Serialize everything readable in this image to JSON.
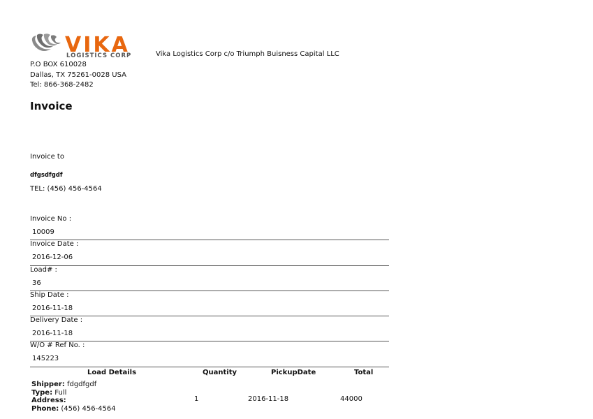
{
  "company": {
    "logo_text": "VIKA",
    "logo_subtext": "LOGISTICS CORP",
    "name": "Vika Logistics Corp c/o Triumph Buisness Capital LLC",
    "address_line1": "P.O BOX 610028",
    "address_line2": "Dallas, TX 75261-0028 USA",
    "tel": "Tel: 866-368-2482",
    "brand_color": "#e8670f",
    "swirl_color": "#7a7a7a"
  },
  "document": {
    "title": "Invoice"
  },
  "bill_to": {
    "label": "Invoice to",
    "name": "dfgsdfgdf",
    "tel": "TEL: (456) 456-4564"
  },
  "meta": [
    {
      "label": "Invoice No :",
      "value": "10009"
    },
    {
      "label": "Invoice Date :",
      "value": "2016-12-06"
    },
    {
      "label": "Load# :",
      "value": "36"
    },
    {
      "label": "Ship Date :",
      "value": "2016-11-18"
    },
    {
      "label": "Delivery Date :",
      "value": "2016-11-18"
    },
    {
      "label": "W/O # Ref No. :",
      "value": "145223"
    }
  ],
  "items_table": {
    "headers": {
      "details": "Load Details",
      "quantity": "Quantity",
      "pickup_date": "PickupDate",
      "total": "Total"
    },
    "rows": [
      {
        "shipper_label": "Shipper:",
        "shipper": "fdgdfgdf",
        "type_label": "Type:",
        "type": "Full",
        "address_label": "Address:",
        "address": "",
        "phone_label": "Phone:",
        "phone": "(456) 456-4564",
        "quantity": "1",
        "pickup_date": "2016-11-18",
        "total": "44000"
      }
    ]
  }
}
